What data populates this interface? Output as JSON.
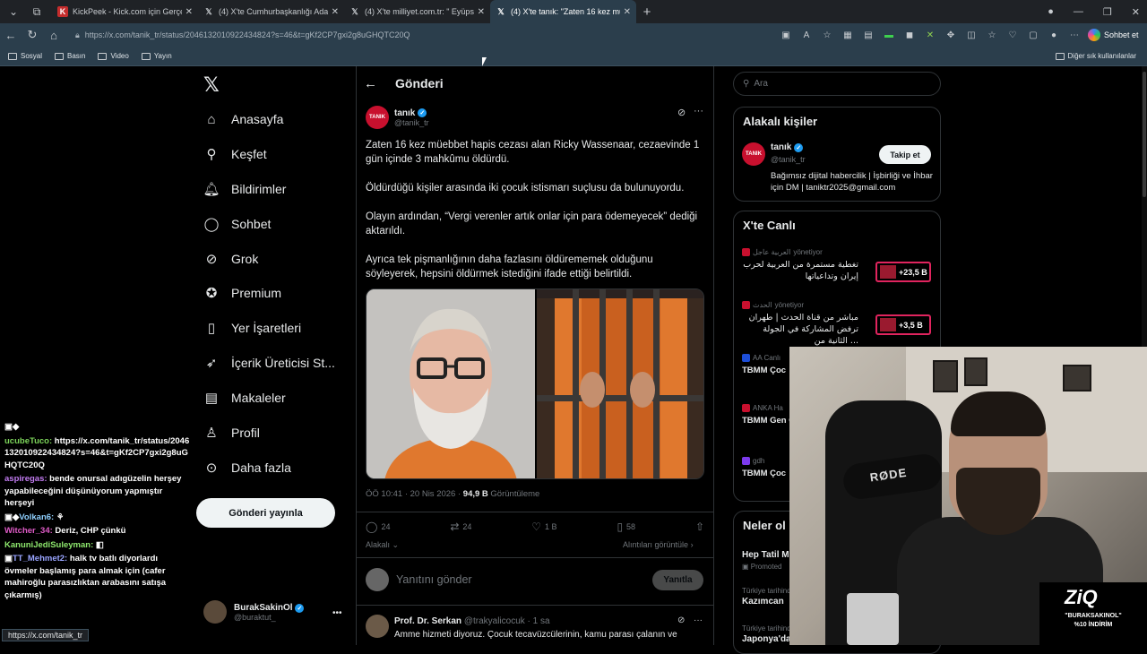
{
  "browser": {
    "tabs": [
      {
        "title": "KickPeek - Kick.com için Gerçek Za",
        "icon": "kickpeek-icon",
        "active": false
      },
      {
        "title": "(4) X'te Cumhurbaşkanlığı Aday Cl",
        "icon": "x-icon",
        "active": false
      },
      {
        "title": "(4) X'te milliyet.com.tr: \" Eyüpsu",
        "icon": "x-icon",
        "active": false
      },
      {
        "title": "(4) X'te tanık: \"Zaten 16 kez müeb",
        "icon": "x-icon",
        "active": true
      }
    ],
    "url": "https://x.com/tanik_tr/status/2046132010922434824?s=46&t=gKf2CP7gxi2g8uGHQTC20Q",
    "sohbet_label": "Sohbet et",
    "bookmarks": [
      "Sosyal",
      "Basın",
      "Video",
      "Yayın"
    ],
    "other_bookmarks": "Diğer sık kullanılanlar"
  },
  "x_nav": {
    "items": [
      {
        "label": "Anasayfa",
        "icon": "home-icon"
      },
      {
        "label": "Keşfet",
        "icon": "search-icon"
      },
      {
        "label": "Bildirimler",
        "icon": "bell-icon"
      },
      {
        "label": "Sohbet",
        "icon": "chat-icon"
      },
      {
        "label": "Grok",
        "icon": "grok-icon"
      },
      {
        "label": "Premium",
        "icon": "premium-icon"
      },
      {
        "label": "Yer İşaretleri",
        "icon": "bookmark-icon"
      },
      {
        "label": "İçerik Üreticisi St...",
        "icon": "rocket-icon"
      },
      {
        "label": "Makaleler",
        "icon": "article-icon"
      },
      {
        "label": "Profil",
        "icon": "profile-icon"
      },
      {
        "label": "Daha fazla",
        "icon": "more-icon"
      }
    ],
    "post_button": "Gönderi yayınla",
    "user_name": "BurakSakinOl",
    "user_handle": "@buraktut_"
  },
  "post": {
    "header": "Gönderi",
    "author_name": "tanık",
    "author_handle": "@tanik_tr",
    "avatar_text": "TANIK",
    "paragraphs": [
      "Zaten 16 kez müebbet hapis cezası alan Ricky Wassenaar, cezaevinde 1 gün içinde 3 mahkûmu öldürdü.",
      "Öldürdüğü kişiler arasında iki çocuk istismarı suçlusu da bulunuyordu.",
      "Olayın ardından, “Vergi verenler artık onlar için para ödemeyecek” dediği aktarıldı.",
      "Ayrıca tek pişmanlığının daha fazlasını öldürememek olduğunu söyleyerek, hepsini öldürmek istediğini ifade ettiği belirtildi."
    ],
    "time": "ÖÖ 10:41 · 20 Nis 2026 · ",
    "views": "94,9 B",
    "views_label": " Görüntüleme",
    "replies": "24",
    "reposts": "24",
    "likes": "1 B",
    "bookmarks": "58",
    "relevance": "Alakalı",
    "quotes_link": "Alıntıları görüntüle",
    "reply_placeholder": "Yanıtını gönder",
    "reply_button": "Yanıtla"
  },
  "comment": {
    "name": "Prof. Dr. Serkan",
    "handle": "@trakyalicocuk · 1 sa",
    "text": "Amme hizmeti diyoruz. Çocuk tecavüzcülerinin, kamu parası çalanın ve"
  },
  "right": {
    "search_placeholder": "Ara",
    "related_title": "Alakalı kişiler",
    "related": {
      "name": "tanık",
      "handle": "@tanik_tr",
      "bio": "Bağımsız dijital habercilik | İşbirliği ve İhbar için DM | taniktr2025@gmail.com",
      "follow": "Takip et"
    },
    "live_title": "X'te Canlı",
    "live": [
      {
        "source": "العربية عاجل",
        "status": "yönetiyor",
        "title": "تغطية مستمرة من العربية لحرب إيران وتداعياتها",
        "count": "+23,5 B"
      },
      {
        "source": "الحدث",
        "status": "yönetiyor",
        "title": "مباشر من قناة الحدث | طهران ترفض المشاركة في الجولة الثانية من ...",
        "count": "+3,5 B"
      },
      {
        "source": "AA Canlı",
        "status": "",
        "title": "TBMM Çoc",
        "count": ""
      },
      {
        "source": "ANKA Ha",
        "status": "",
        "title": "TBMM Gen Çocuk Öze",
        "count": ""
      },
      {
        "source": "gdh",
        "status": "",
        "title": "TBMM Çoc",
        "count": ""
      }
    ],
    "trends_title": "Neler ol",
    "trends": [
      {
        "category": "",
        "name": "Hep Tatil M",
        "meta": "Promoted"
      },
      {
        "category": "Türkiye tarihinde gündemde",
        "name": "Kazımcan"
      },
      {
        "category": "Türkiye tarihinde gündemde",
        "name": "Japonya'da 7,4"
      }
    ]
  },
  "chat": [
    {
      "user": "ucubeTuco:",
      "color": "#7cd45a",
      "text": "https://x.com/tanik_tr/status/2046132010922434824?s=46&t=gKf2CP7gxi2g8uGHQTC20Q"
    },
    {
      "user": "aspiregas:",
      "color": "#c37cf2",
      "text": "bende onursal adıgüzelin herşey yapabileceğini düşünüyorum yapmıştır herşeyi"
    },
    {
      "user": "Volkan6:",
      "color": "#ffffff",
      "text": ""
    },
    {
      "user": "Witcher_34:",
      "color": "#e05cc8",
      "text": "Deriz, CHP çünkü"
    },
    {
      "user": "KanuniJediSuleyman:",
      "color": "#8ee86d",
      "text": ""
    },
    {
      "user": "TT_Mehmet2:",
      "color": "#9aa5ff",
      "text": "halk tv batlı diyorlardı övmeler başlamış para almak için (cafer mahiroğlu parasızlıktan arabasını satışa çıkarmış)"
    }
  ],
  "status_url": "https://x.com/tanik_tr",
  "stream_overlay": {
    "brand": "ZiQ",
    "line1": "\"BURAKSAKINOL\"",
    "line2": "%10 İNDİRİM"
  },
  "colors": {
    "x_blue": "#1d9bf0",
    "browser_chrome": "#2b3e4c",
    "live_pill": "#e0245e"
  }
}
